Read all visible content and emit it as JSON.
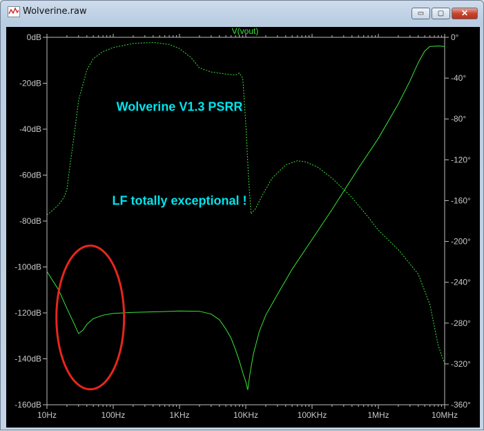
{
  "window": {
    "title": "Wolverine.raw",
    "icon": "waveform-plot-icon",
    "buttons": {
      "minimize": "▭",
      "maximize": "▢",
      "close": "✕"
    }
  },
  "colors": {
    "background": "#000000",
    "trace": "#38e838",
    "axes": "#c0c0c0",
    "text": "#c8c8c8",
    "annotation_text": "#00e5ee",
    "highlight_circle": "#e8261c"
  },
  "chart_data": {
    "type": "line",
    "title": "V(vout)",
    "x_scale": "log",
    "xlim": [
      10,
      10000000
    ],
    "x_ticks": [
      10,
      100,
      1000,
      10000,
      100000,
      1000000,
      10000000
    ],
    "x_tick_labels": [
      "10Hz",
      "100Hz",
      "1KHz",
      "10KHz",
      "100KHz",
      "1MHz",
      "10MHz"
    ],
    "ylim_left": [
      -160,
      0
    ],
    "y_ticks_left": [
      0,
      -20,
      -40,
      -60,
      -80,
      -100,
      -120,
      -140,
      -160
    ],
    "y_tick_labels_left": [
      "0dB",
      "-20dB",
      "-40dB",
      "-60dB",
      "-80dB",
      "-100dB",
      "-120dB",
      "-140dB",
      "-160dB"
    ],
    "ylim_right": [
      -360,
      0
    ],
    "y_ticks_right": [
      0,
      -40,
      -80,
      -120,
      -160,
      -200,
      -240,
      -280,
      -320,
      -360
    ],
    "y_tick_labels_right": [
      "0°",
      "-40°",
      "-80°",
      "-120°",
      "-160°",
      "-200°",
      "-240°",
      "-280°",
      "-320°",
      "-360°"
    ],
    "grid": false,
    "series": [
      {
        "quantity": "magnitude_dB",
        "axis": "left",
        "style": "solid",
        "points": [
          [
            10,
            -102
          ],
          [
            15,
            -110
          ],
          [
            20,
            -118
          ],
          [
            25,
            -124
          ],
          [
            30,
            -129
          ],
          [
            35,
            -127.5
          ],
          [
            40,
            -125
          ],
          [
            50,
            -122.5
          ],
          [
            70,
            -121
          ],
          [
            100,
            -120.2
          ],
          [
            200,
            -119.8
          ],
          [
            500,
            -119.5
          ],
          [
            1000,
            -119.2
          ],
          [
            2000,
            -119.3
          ],
          [
            3000,
            -120.5
          ],
          [
            4000,
            -123
          ],
          [
            5000,
            -127
          ],
          [
            6000,
            -131
          ],
          [
            7000,
            -136
          ],
          [
            8000,
            -141
          ],
          [
            9000,
            -146
          ],
          [
            10000,
            -150
          ],
          [
            10700,
            -153.5
          ],
          [
            11500,
            -147
          ],
          [
            13000,
            -138
          ],
          [
            16000,
            -128
          ],
          [
            20000,
            -121
          ],
          [
            30000,
            -112
          ],
          [
            50000,
            -101
          ],
          [
            100000,
            -88
          ],
          [
            200000,
            -75
          ],
          [
            500000,
            -57
          ],
          [
            1000000,
            -44
          ],
          [
            2000000,
            -29
          ],
          [
            3000000,
            -19
          ],
          [
            4000000,
            -11
          ],
          [
            5000000,
            -6
          ],
          [
            6000000,
            -4
          ],
          [
            8000000,
            -3.8
          ],
          [
            10000000,
            -4
          ]
        ]
      },
      {
        "quantity": "phase_deg",
        "axis": "right",
        "style": "dashed",
        "points": [
          [
            10,
            -174
          ],
          [
            12,
            -170
          ],
          [
            15,
            -164
          ],
          [
            18,
            -157
          ],
          [
            20,
            -149
          ],
          [
            22,
            -128
          ],
          [
            25,
            -102
          ],
          [
            30,
            -62
          ],
          [
            40,
            -32
          ],
          [
            50,
            -21
          ],
          [
            70,
            -14
          ],
          [
            100,
            -10
          ],
          [
            200,
            -6
          ],
          [
            400,
            -5
          ],
          [
            700,
            -7
          ],
          [
            1000,
            -11
          ],
          [
            1500,
            -20
          ],
          [
            2000,
            -30
          ],
          [
            3000,
            -34
          ],
          [
            5000,
            -36
          ],
          [
            7000,
            -37
          ],
          [
            8000,
            -35
          ],
          [
            9000,
            -40
          ],
          [
            10000,
            -85
          ],
          [
            11000,
            -138
          ],
          [
            12000,
            -173
          ],
          [
            14000,
            -168
          ],
          [
            18000,
            -154
          ],
          [
            25000,
            -138
          ],
          [
            40000,
            -125
          ],
          [
            60000,
            -121
          ],
          [
            80000,
            -122
          ],
          [
            120000,
            -127
          ],
          [
            200000,
            -138
          ],
          [
            400000,
            -157
          ],
          [
            700000,
            -176
          ],
          [
            1000000,
            -189
          ],
          [
            2000000,
            -208
          ],
          [
            4000000,
            -232
          ],
          [
            6000000,
            -262
          ],
          [
            8000000,
            -302
          ],
          [
            10000000,
            -320
          ]
        ]
      }
    ],
    "annotations": [
      {
        "text": "Wolverine V1.3 PSRR",
        "x": 1000,
        "y_dB": -32
      },
      {
        "text": "LF totally exceptional !",
        "x": 1000,
        "y_dB": -73
      }
    ],
    "highlight": {
      "shape": "ellipse",
      "center": [
        45,
        -122
      ],
      "note": "LF dip region"
    }
  }
}
